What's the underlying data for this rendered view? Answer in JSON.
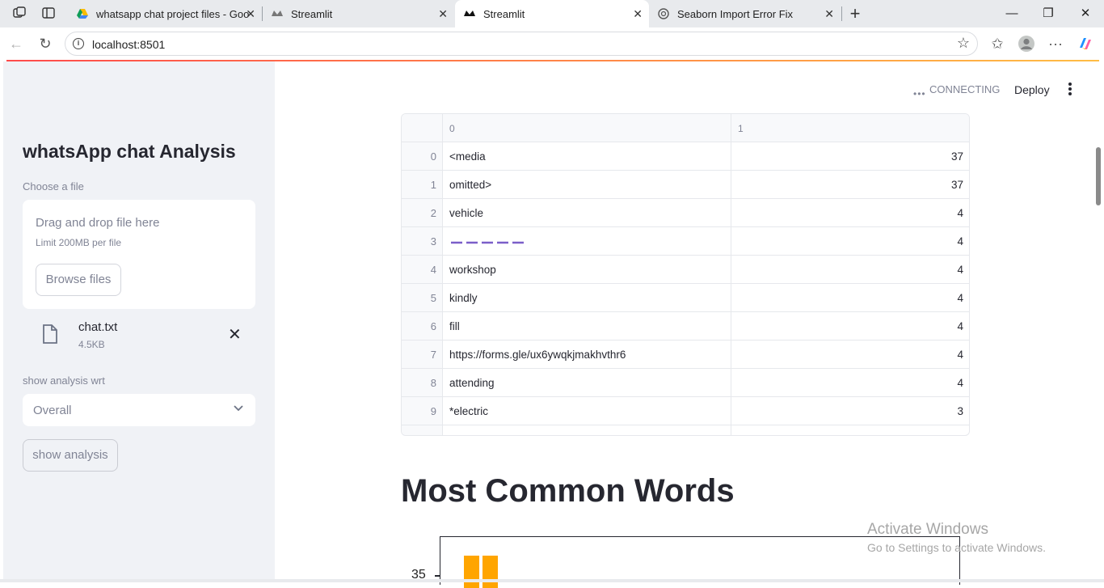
{
  "browser": {
    "tabs": [
      {
        "title": "whatsapp chat project files - Goo"
      },
      {
        "title": "Streamlit"
      },
      {
        "title": "Streamlit"
      },
      {
        "title": "Seaborn Import Error Fix"
      }
    ],
    "url": "localhost:8501"
  },
  "sidebar": {
    "title": "whatsApp chat Analysis",
    "uploader_label": "Choose a file",
    "drag_text": "Drag and drop file here",
    "limit_text": "Limit 200MB per file",
    "browse_label": "Browse files",
    "file": {
      "name": "chat.txt",
      "size": "4.5KB"
    },
    "select_label": "show analysis wrt",
    "select_value": "Overall",
    "show_button": "show analysis"
  },
  "header": {
    "status": "CONNECTING",
    "deploy": "Deploy"
  },
  "dataframe": {
    "columns": [
      "0",
      "1"
    ],
    "rows": [
      {
        "idx": "0",
        "word": "<media",
        "count": "37"
      },
      {
        "idx": "1",
        "word": "omitted>",
        "count": "37"
      },
      {
        "idx": "2",
        "word": "vehicle",
        "count": "4"
      },
      {
        "idx": "3",
        "word": "",
        "count": "4"
      },
      {
        "idx": "4",
        "word": "workshop",
        "count": "4"
      },
      {
        "idx": "5",
        "word": "kindly",
        "count": "4"
      },
      {
        "idx": "6",
        "word": "fill",
        "count": "4"
      },
      {
        "idx": "7",
        "word": "https://forms.gle/ux6ywqkjmakhvthr6",
        "count": "4"
      },
      {
        "idx": "8",
        "word": "attending",
        "count": "4"
      },
      {
        "idx": "9",
        "word": "*electric",
        "count": "3"
      }
    ]
  },
  "section_title": "Most Common Words",
  "chart_data": {
    "type": "bar",
    "ytick_visible": "35",
    "bar_color": "#ffa500"
  },
  "watermark": {
    "line1": "Activate Windows",
    "line2": "Go to Settings to activate Windows."
  }
}
